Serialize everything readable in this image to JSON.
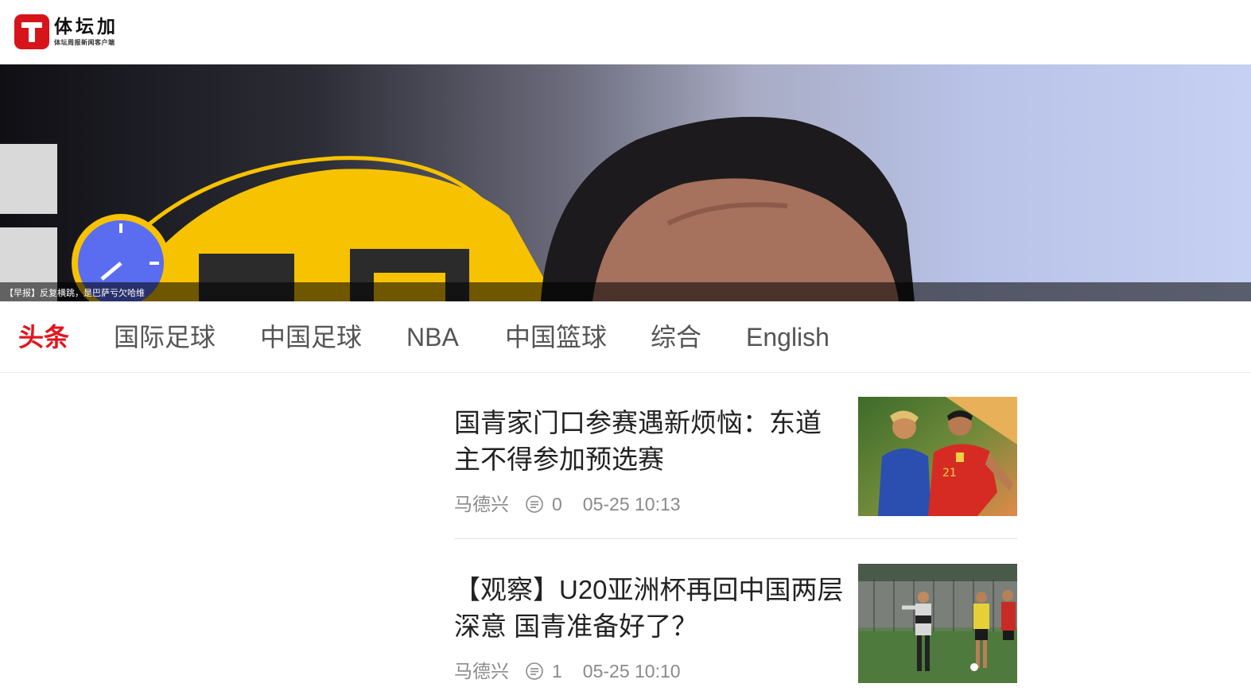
{
  "header": {
    "logo_name": "体坛加",
    "logo_subtitle": "体坛周报新闻客户端"
  },
  "banner": {
    "caption": "【早报】反复横跳，是巴萨亏欠哈维"
  },
  "nav": {
    "tabs": [
      {
        "label": "头条",
        "active": true
      },
      {
        "label": "国际足球",
        "active": false
      },
      {
        "label": "中国足球",
        "active": false
      },
      {
        "label": "NBA",
        "active": false
      },
      {
        "label": "中国篮球",
        "active": false
      },
      {
        "label": "综合",
        "active": false
      },
      {
        "label": "English",
        "active": false
      }
    ]
  },
  "feed": {
    "items": [
      {
        "title": "国青家门口参赛遇新烦恼：东道主不得参加预选赛",
        "author": "马德兴",
        "comments": "0",
        "time": "05-25 10:13",
        "thumb_icon": "football-players-photo"
      },
      {
        "title": "【观察】U20亚洲杯再回中国两层深意 国青准备好了？",
        "author": "马德兴",
        "comments": "1",
        "time": "05-25 10:10",
        "thumb_icon": "training-session-photo"
      }
    ]
  },
  "colors": {
    "brand_red": "#d8141b",
    "active_tab": "#e0161e",
    "meta_gray": "#8a8a8a"
  }
}
